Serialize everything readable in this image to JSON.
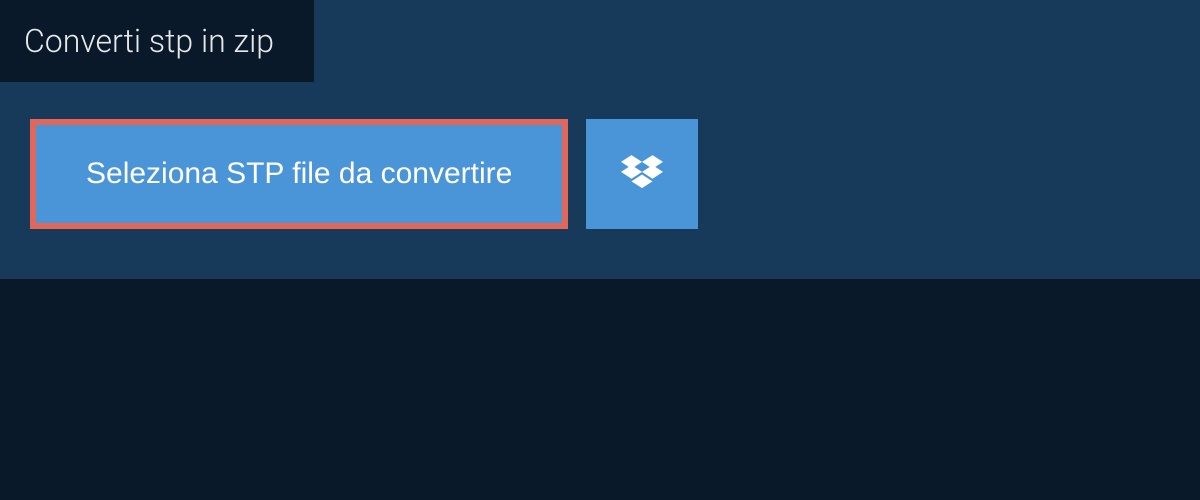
{
  "tab": {
    "label": "Converti stp in zip"
  },
  "buttons": {
    "select_file": "Seleziona STP file da convertire"
  },
  "colors": {
    "background_dark": "#0a1929",
    "panel": "#183a5a",
    "button": "#4a94d8",
    "highlight_border": "#e0675a"
  }
}
